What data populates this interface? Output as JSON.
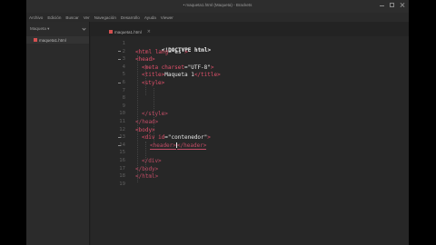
{
  "window": {
    "title": "• maqueta1.html (Maqueta) - Brackets"
  },
  "menu": [
    "Archivo",
    "Edición",
    "Buscar",
    "Ver",
    "Navegación",
    "Desarrollo",
    "Ayuda",
    "Viewer"
  ],
  "sidebar": {
    "project": "Maqueta ▾",
    "files": [
      {
        "name": "maqueta1.html"
      }
    ]
  },
  "tabs": [
    {
      "name": "maqueta1.html"
    }
  ],
  "editor": {
    "line_numbers": [
      "1",
      "2",
      "3",
      "4",
      "5",
      "6",
      "7",
      "8",
      "9",
      "10",
      "11",
      "12",
      "13",
      "14",
      "15",
      "16",
      "17",
      "18",
      "19"
    ],
    "code": {
      "l1_doctype": "<!DOCTYPE html>",
      "l2_open": "<html ",
      "l2_attr": "lang",
      "l2_eq": "=",
      "l2_val": "\"es\"",
      "l2_close": ">",
      "l3": "<head>",
      "l4_open": "<meta ",
      "l4_attr": "charset",
      "l4_eq": "=",
      "l4_val": "\"UTF-8\"",
      "l4_close": ">",
      "l5_open": "<title>",
      "l5_text": "Maqueta 1",
      "l5_close": "</title>",
      "l6": "<style>",
      "l10": "</style>",
      "l11": "</head>",
      "l12": "<body>",
      "l13_open": "<div ",
      "l13_attr": "id",
      "l13_eq": "=",
      "l13_val": "\"contenedor\"",
      "l13_close": ">",
      "l14_a": "<header>",
      "l14_b": "</header>",
      "l16": "</div>",
      "l17": "</body>",
      "l18": "</html>"
    }
  }
}
